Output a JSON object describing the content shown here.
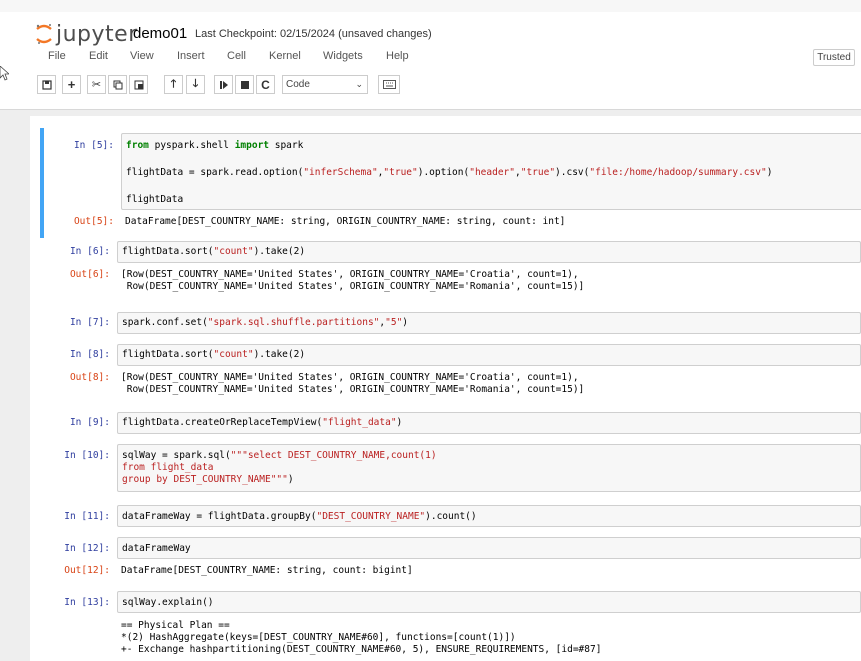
{
  "app": {
    "logo_text": "jupyter",
    "notebook_name": "demo01",
    "checkpoint": "Last Checkpoint: 02/15/2024  (unsaved changes)",
    "trusted_label": "Trusted"
  },
  "menu": [
    "File",
    "Edit",
    "View",
    "Insert",
    "Cell",
    "Kernel",
    "Widgets",
    "Help"
  ],
  "toolbar": {
    "icons": [
      "save-icon",
      "add-cell-icon",
      "cut-icon",
      "copy-icon",
      "paste-icon",
      "move-up-icon",
      "move-down-icon",
      "run-icon",
      "stop-icon",
      "restart-icon"
    ],
    "cell_type": "Code",
    "keyboard_icon": "keyboard-icon"
  },
  "cells": [
    {
      "prompt": "In  [5]:",
      "lines": [
        "from pyspark.shell import spark",
        "",
        "flightData = spark.read.option(\"inferSchema\",\"true\").option(\"header\",\"true\").csv(\"file:/home/hadoop/summary.csv\")",
        "",
        "flightData"
      ],
      "out_prompt": "Out[5]:",
      "output": [
        "DataFrame[DEST_COUNTRY_NAME: string, ORIGIN_COUNTRY_NAME: string, count: int]"
      ]
    },
    {
      "prompt": "In  [6]:",
      "lines": [
        "flightData.sort(\"count\").take(2)"
      ],
      "out_prompt": "Out[6]:",
      "output": [
        "[Row(DEST_COUNTRY_NAME='United States', ORIGIN_COUNTRY_NAME='Croatia', count=1),",
        " Row(DEST_COUNTRY_NAME='United States', ORIGIN_COUNTRY_NAME='Romania', count=15)]"
      ]
    },
    {
      "prompt": "In  [7]:",
      "lines": [
        "spark.conf.set(\"spark.sql.shuffle.partitions\",\"5\")"
      ]
    },
    {
      "prompt": "In  [8]:",
      "lines": [
        "flightData.sort(\"count\").take(2)"
      ],
      "out_prompt": "Out[8]:",
      "output": [
        "[Row(DEST_COUNTRY_NAME='United States', ORIGIN_COUNTRY_NAME='Croatia', count=1),",
        " Row(DEST_COUNTRY_NAME='United States', ORIGIN_COUNTRY_NAME='Romania', count=15)]"
      ]
    },
    {
      "prompt": "In  [9]:",
      "lines": [
        "flightData.createOrReplaceTempView(\"flight_data\")"
      ]
    },
    {
      "prompt": "In  [10]:",
      "lines": [
        "sqlWay = spark.sql(\"\"\"select DEST_COUNTRY_NAME,count(1)",
        "from flight_data",
        "group by DEST_COUNTRY_NAME\"\"\")"
      ]
    },
    {
      "prompt": "In  [11]:",
      "lines": [
        "dataFrameWay = flightData.groupBy(\"DEST_COUNTRY_NAME\").count()"
      ]
    },
    {
      "prompt": "In  [12]:",
      "lines": [
        "dataFrameWay"
      ],
      "out_prompt": "Out[12]:",
      "output": [
        "DataFrame[DEST_COUNTRY_NAME: string, count: bigint]"
      ]
    },
    {
      "prompt": "In  [13]:",
      "lines": [
        "sqlWay.explain()"
      ],
      "output": [
        "== Physical Plan ==",
        "*(2) HashAggregate(keys=[DEST_COUNTRY_NAME#60], functions=[count(1)])",
        "+- Exchange hashpartitioning(DEST_COUNTRY_NAME#60, 5), ENSURE_REQUIREMENTS, [id=#87]"
      ]
    }
  ]
}
